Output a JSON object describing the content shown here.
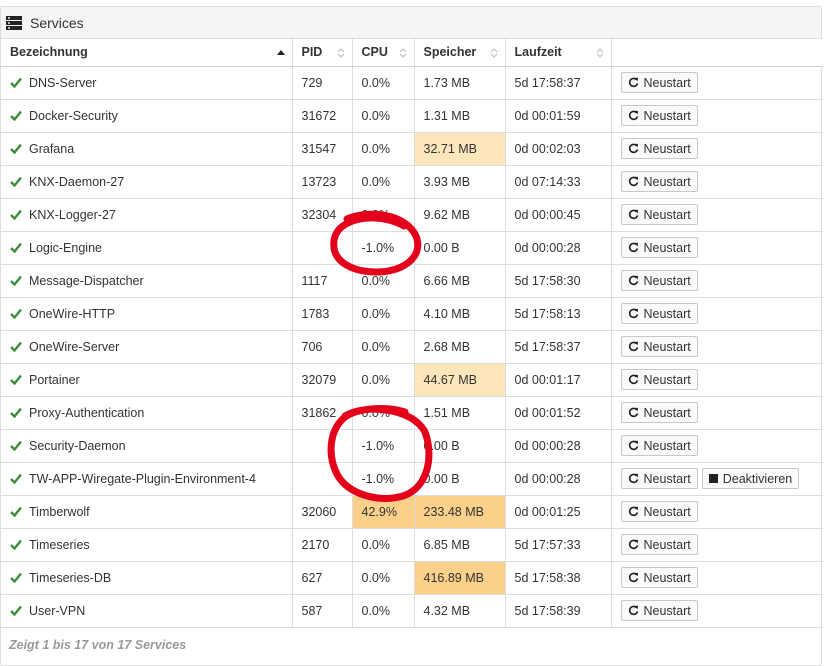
{
  "panel": {
    "title": "Services",
    "icon": "server-list-icon"
  },
  "table": {
    "columns": [
      "Bezeichnung",
      "PID",
      "CPU",
      "Speicher",
      "Laufzeit"
    ],
    "sort": {
      "column": "Bezeichnung",
      "direction": "ascending"
    },
    "restart_label": "Neustart",
    "deactivate_label": "Deaktivieren",
    "rows": [
      {
        "name": "DNS-Server",
        "pid": "729",
        "cpu": "0.0%",
        "mem": "1.73 MB",
        "uptime": "5d 17:58:37"
      },
      {
        "name": "Docker-Security",
        "pid": "31672",
        "cpu": "0.0%",
        "mem": "1.31 MB",
        "uptime": "0d 00:01:59"
      },
      {
        "name": "Grafana",
        "pid": "31547",
        "cpu": "0.0%",
        "mem": "32.71 MB",
        "uptime": "0d 00:02:03"
      },
      {
        "name": "KNX-Daemon-27",
        "pid": "13723",
        "cpu": "0.0%",
        "mem": "3.93 MB",
        "uptime": "0d 07:14:33"
      },
      {
        "name": "KNX-Logger-27",
        "pid": "32304",
        "cpu": "0.0%",
        "mem": "9.62 MB",
        "uptime": "0d 00:00:45"
      },
      {
        "name": "Logic-Engine",
        "pid": "",
        "cpu": "-1.0%",
        "mem": "0.00 B",
        "uptime": "0d 00:00:28"
      },
      {
        "name": "Message-Dispatcher",
        "pid": "1117",
        "cpu": "0.0%",
        "mem": "6.66 MB",
        "uptime": "5d 17:58:30"
      },
      {
        "name": "OneWire-HTTP",
        "pid": "1783",
        "cpu": "0.0%",
        "mem": "4.10 MB",
        "uptime": "5d 17:58:13"
      },
      {
        "name": "OneWire-Server",
        "pid": "706",
        "cpu": "0.0%",
        "mem": "2.68 MB",
        "uptime": "5d 17:58:37"
      },
      {
        "name": "Portainer",
        "pid": "32079",
        "cpu": "0.0%",
        "mem": "44.67 MB",
        "uptime": "0d 00:01:17"
      },
      {
        "name": "Proxy-Authentication",
        "pid": "31862",
        "cpu": "0.0%",
        "mem": "1.51 MB",
        "uptime": "0d 00:01:52"
      },
      {
        "name": "Security-Daemon",
        "pid": "",
        "cpu": "-1.0%",
        "mem": "0.00 B",
        "uptime": "0d 00:00:28"
      },
      {
        "name": "TW-APP-Wiregate-Plugin-Environment-4",
        "pid": "",
        "cpu": "-1.0%",
        "mem": "0.00 B",
        "uptime": "0d 00:00:28"
      },
      {
        "name": "Timberwolf",
        "pid": "32060",
        "cpu": "42.9%",
        "mem": "233.48 MB",
        "uptime": "0d 00:01:25"
      },
      {
        "name": "Timeseries",
        "pid": "2170",
        "cpu": "0.0%",
        "mem": "6.85 MB",
        "uptime": "5d 17:57:33"
      },
      {
        "name": "Timeseries-DB",
        "pid": "627",
        "cpu": "0.0%",
        "mem": "416.89 MB",
        "uptime": "5d 17:58:38"
      },
      {
        "name": "User-VPN",
        "pid": "587",
        "cpu": "0.0%",
        "mem": "4.32 MB",
        "uptime": "5d 17:58:39"
      }
    ]
  },
  "footer": {
    "info": "Zeigt 1 bis 17 von 17 Services"
  },
  "colors": {
    "status_ok": "#3c8c3c",
    "highlight_light": "#fde6bc",
    "highlight_strong": "#fbd08b",
    "annotation_red": "#e4001b"
  }
}
